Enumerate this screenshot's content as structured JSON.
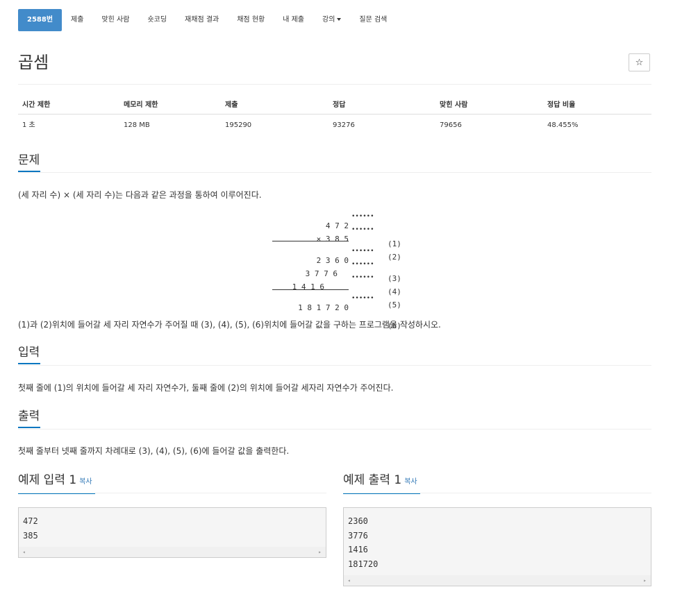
{
  "nav": {
    "items": [
      "2588번",
      "제출",
      "맞힌 사람",
      "숏코딩",
      "재채점 결과",
      "채점 현황",
      "내 제출",
      "강의",
      "질문 검색"
    ]
  },
  "problem": {
    "title": "곱셈",
    "star": "☆"
  },
  "info": {
    "headers": [
      "시간 제한",
      "메모리 제한",
      "제출",
      "정답",
      "맞힌 사람",
      "정답 비율"
    ],
    "values": [
      "1 초",
      "128 MB",
      "195290",
      "93276",
      "79656",
      "48.455%"
    ]
  },
  "sections": {
    "problem_title": "문제",
    "problem_text": "(세 자리 수) × (세 자리 수)는 다음과 같은 과정을 통하여 이루어진다.",
    "problem_text2": "(1)과 (2)위치에 들어갈 세 자리 자연수가 주어질 때 (3), (4), (5), (6)위치에 들어갈 값을 구하는 프로그램을 작성하시오.",
    "input_title": "입력",
    "input_text": "첫째 줄에 (1)의 위치에 들어갈 세 자리 자연수가, 둘째 줄에 (2)의 위치에 들어갈 세자리 자연수가 주어진다.",
    "output_title": "출력",
    "output_text": "첫째 줄부터 넷째 줄까지 차례대로 (3), (4), (5), (6)에 들어갈 값을 출력한다."
  },
  "figure": {
    "rows": [
      {
        "num": "4 7 2",
        "dots": "••••••",
        "label": "(1)"
      },
      {
        "num": "× 3 8 5",
        "dots": "••••••",
        "label": "(2)"
      },
      {
        "num": "2 3 6 0",
        "dots": "••••••",
        "label": "(3)"
      },
      {
        "num": "3 7 7 6",
        "dots": "••••••",
        "label": "(4)"
      },
      {
        "num": "1 4 1 6",
        "dots": "••••••",
        "label": "(5)"
      },
      {
        "num": "1 8 1 7 2 0",
        "dots": "••••••",
        "label": "(6)"
      }
    ]
  },
  "samples": {
    "input_title": "예제 입력 1",
    "output_title": "예제 출력 1",
    "copy_label": "복사",
    "input_lines": [
      "472",
      "385"
    ],
    "output_lines": [
      "2360",
      "3776",
      "1416",
      "181720"
    ]
  },
  "icons": {
    "scroll_left": "◂",
    "scroll_right": "▸"
  },
  "colors": {
    "accent": "#428bca",
    "underline": "#0076c0",
    "link": "#337ab7"
  }
}
